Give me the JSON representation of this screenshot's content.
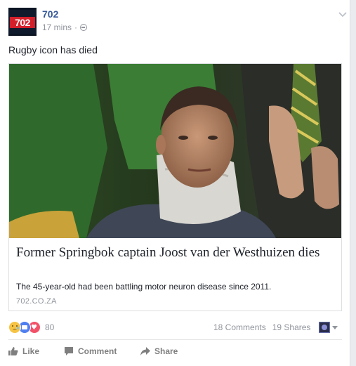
{
  "post": {
    "page_name": "702",
    "logo_text": "702",
    "timestamp": "17 mins",
    "separator": "·",
    "audience_icon": "globe-icon",
    "menu_icon": "chevron-down-icon",
    "text": "Rugby icon has died"
  },
  "link_preview": {
    "title": "Former Springbok captain Joost van der Westhuizen dies",
    "description": "The 45-year-old had been battling motor neuron disease since 2011.",
    "domain": "702.CO.ZA"
  },
  "stats": {
    "reaction_icons": [
      "sad-reaction-icon",
      "like-reaction-icon",
      "love-reaction-icon"
    ],
    "reaction_count": "80",
    "comments": "18 Comments",
    "shares": "19 Shares"
  },
  "actions": {
    "like_label": "Like",
    "comment_label": "Comment",
    "share_label": "Share"
  },
  "colors": {
    "link_blue": "#365899",
    "meta_gray": "#90949c",
    "logo_bg": "#0f1a2c",
    "logo_red": "#d31f2a"
  }
}
